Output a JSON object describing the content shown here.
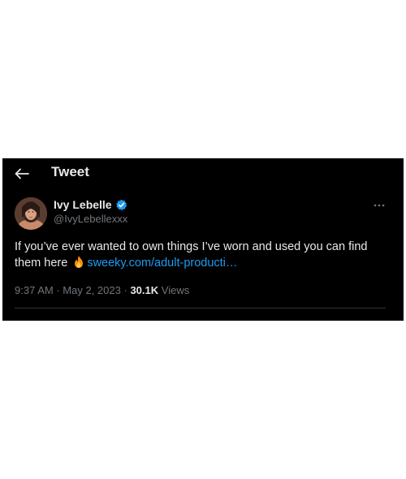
{
  "header": {
    "title": "Tweet",
    "back_icon": "arrow-left-icon"
  },
  "tweet": {
    "author": {
      "display_name": "Ivy Lebelle",
      "handle": "@IvyLebellexxx",
      "verified": true,
      "verified_color": "#1d9bf0",
      "avatar_icon": "profile-photo"
    },
    "more_icon": "ellipsis-icon",
    "text_main": "If you’ve ever wanted to own things I’ve worn and used you can find them here",
    "emoji": "fire-icon",
    "link_text": "sweeky.com/adult-producti…",
    "time": "9:37 AM",
    "date": "May 2, 2023",
    "separator": "·",
    "views_count": "30.1K",
    "views_label": "Views"
  },
  "colors": {
    "background": "#000000",
    "text": "#e7e9ea",
    "secondary": "#71767b",
    "link": "#1d9bf0",
    "divider": "#2f3336"
  }
}
